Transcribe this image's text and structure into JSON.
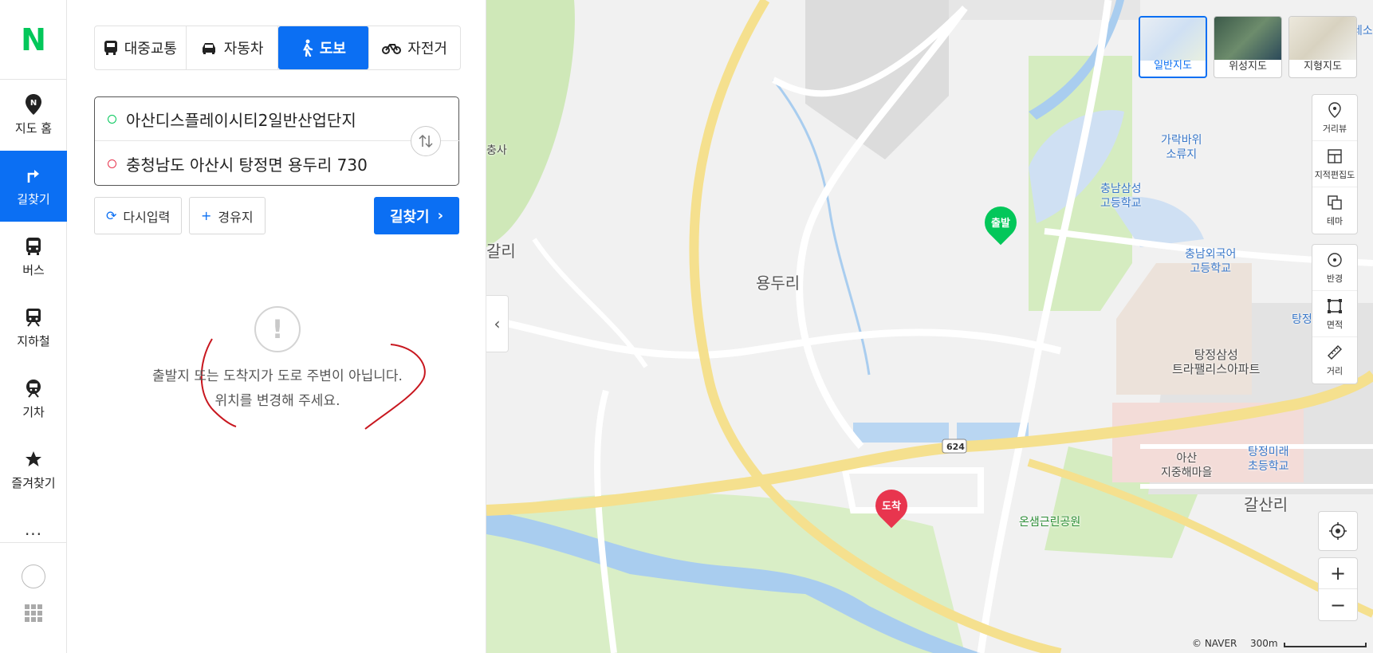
{
  "app": {
    "logo": "N",
    "brand_color": "#03c75a",
    "accent_color": "#0b6ff3"
  },
  "rail": {
    "items": [
      {
        "label": "지도 홈",
        "icon": "map-home-icon"
      },
      {
        "label": "길찾기",
        "icon": "directions-icon",
        "active": true
      },
      {
        "label": "버스",
        "icon": "bus-icon"
      },
      {
        "label": "지하철",
        "icon": "subway-icon"
      },
      {
        "label": "기차",
        "icon": "train-icon"
      },
      {
        "label": "즐겨찾기",
        "icon": "star-icon"
      }
    ],
    "more": "..."
  },
  "panel": {
    "modes": [
      {
        "label": "대중교통",
        "icon": "bus-icon"
      },
      {
        "label": "자동차",
        "icon": "car-icon"
      },
      {
        "label": "도보",
        "icon": "walk-icon",
        "active": true
      },
      {
        "label": "자전거",
        "icon": "bicycle-icon"
      }
    ],
    "start_value": "아산디스플레이시티2일반산업단지",
    "goal_value": "충청남도 아산시 탕정면 용두리 730",
    "reset_label": "다시입력",
    "waypoint_label": "경유지",
    "search_label": "길찾기",
    "notice_line1": "출발지 또는 도착지가 도로 주변이 아닙니다.",
    "notice_line2": "위치를 변경해 주세요."
  },
  "map": {
    "labels": {
      "yongduri": "용두리",
      "galsanri": "갈산리",
      "garakbawi": "가락바위\n소류지",
      "chungnam_samsung_hs": "충남삼성\n고등학교",
      "chungnam_foreign_hs": "충남외국어\n고등학교",
      "tangjeong_apt": "탕정삼성\n트라팰리스아파트",
      "asan_village": "아산\n지중해마을",
      "tangjeong_elem": "탕정미래\n초등학교",
      "onsaem_park": "온샘근린공원",
      "road_624": "624",
      "edge_left": "갈리",
      "edge_left_top": "충사",
      "edge_right": "탕정",
      "edge_right_top": "레소"
    },
    "start_marker": "출발",
    "goal_marker": "도착",
    "map_types": [
      {
        "label": "일반지도",
        "active": true
      },
      {
        "label": "위성지도"
      },
      {
        "label": "지형지도"
      }
    ],
    "tools_a": [
      {
        "label": "거리뷰",
        "icon": "street-view-icon"
      },
      {
        "label": "지적편집도",
        "icon": "cadastral-icon"
      },
      {
        "label": "테마",
        "icon": "theme-icon"
      }
    ],
    "tools_b": [
      {
        "label": "반경",
        "icon": "radius-icon"
      },
      {
        "label": "면적",
        "icon": "area-icon"
      },
      {
        "label": "거리",
        "icon": "ruler-icon"
      }
    ],
    "zoom_in": "+",
    "zoom_out": "−",
    "copyright": "© NAVER",
    "scale": "300m"
  }
}
